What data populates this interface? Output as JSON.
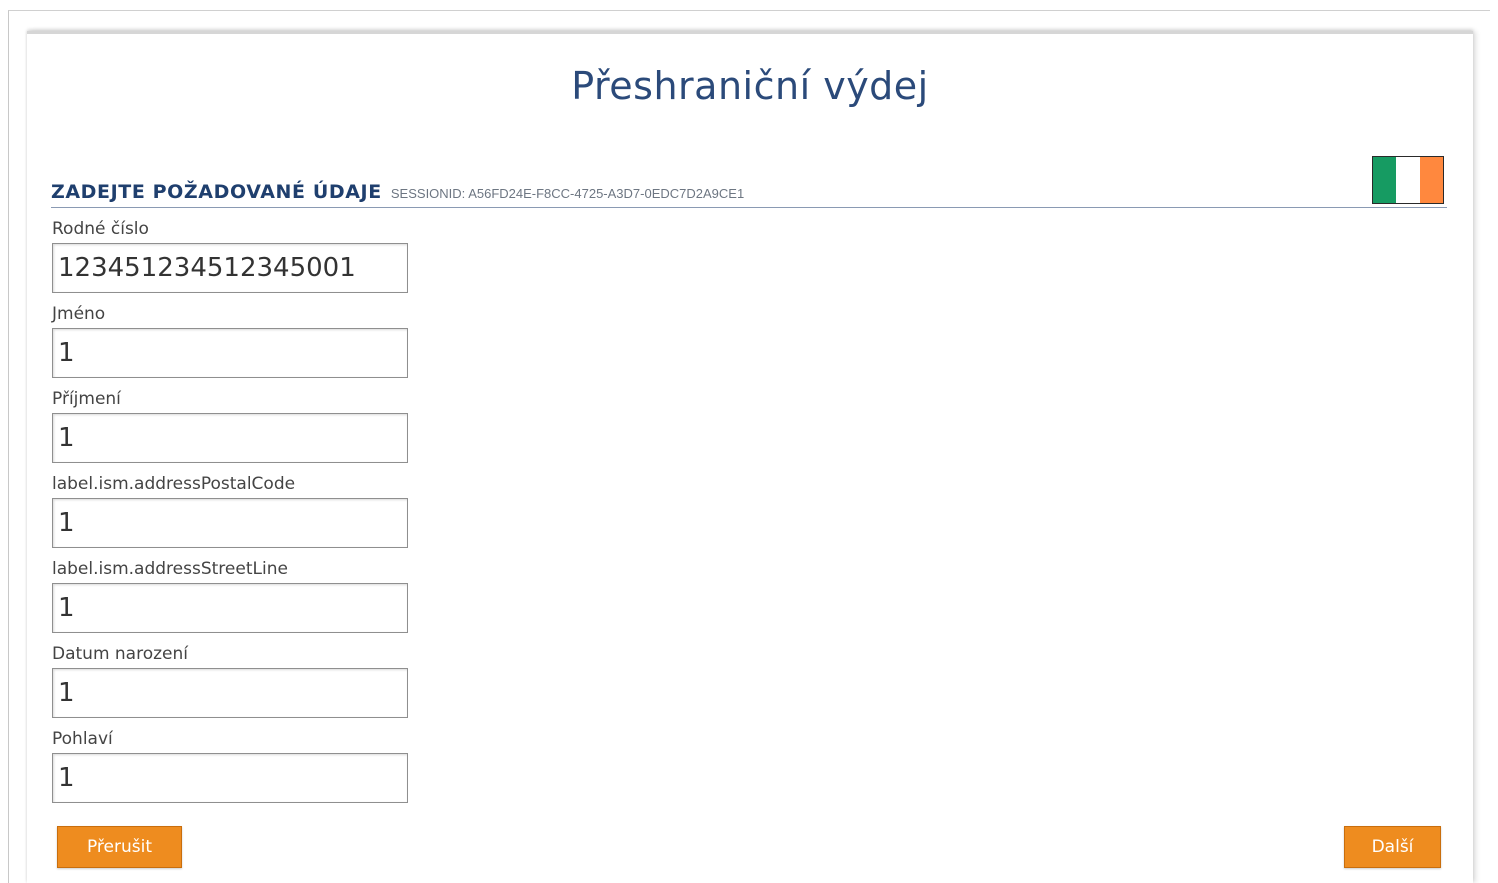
{
  "page": {
    "title": "Přeshraniční výdej"
  },
  "section": {
    "title": "ZADEJTE POŽADOVANÉ ÚDAJE",
    "session_id": "SESSIONID: A56FD24E-F8CC-4725-A3D7-0EDC7D2A9CE1"
  },
  "flag": {
    "icon": "ireland-flag-icon",
    "colors": [
      "#169b62",
      "#ffffff",
      "#ff883e"
    ]
  },
  "form": {
    "fields": [
      {
        "label": "Rodné číslo",
        "value": "123451234512345001"
      },
      {
        "label": "Jméno",
        "value": "1"
      },
      {
        "label": "Příjmení",
        "value": "1"
      },
      {
        "label": "label.ism.addressPostalCode",
        "value": "1"
      },
      {
        "label": "label.ism.addressStreetLine",
        "value": "1"
      },
      {
        "label": "Datum narození",
        "value": "1"
      },
      {
        "label": "Pohlaví",
        "value": "1"
      }
    ]
  },
  "buttons": {
    "cancel_label": "Přerušit",
    "next_label": "Další"
  },
  "colors": {
    "title": "#2b4a7a",
    "section_title": "#1f3f6e",
    "button": "#ee8c1f"
  }
}
